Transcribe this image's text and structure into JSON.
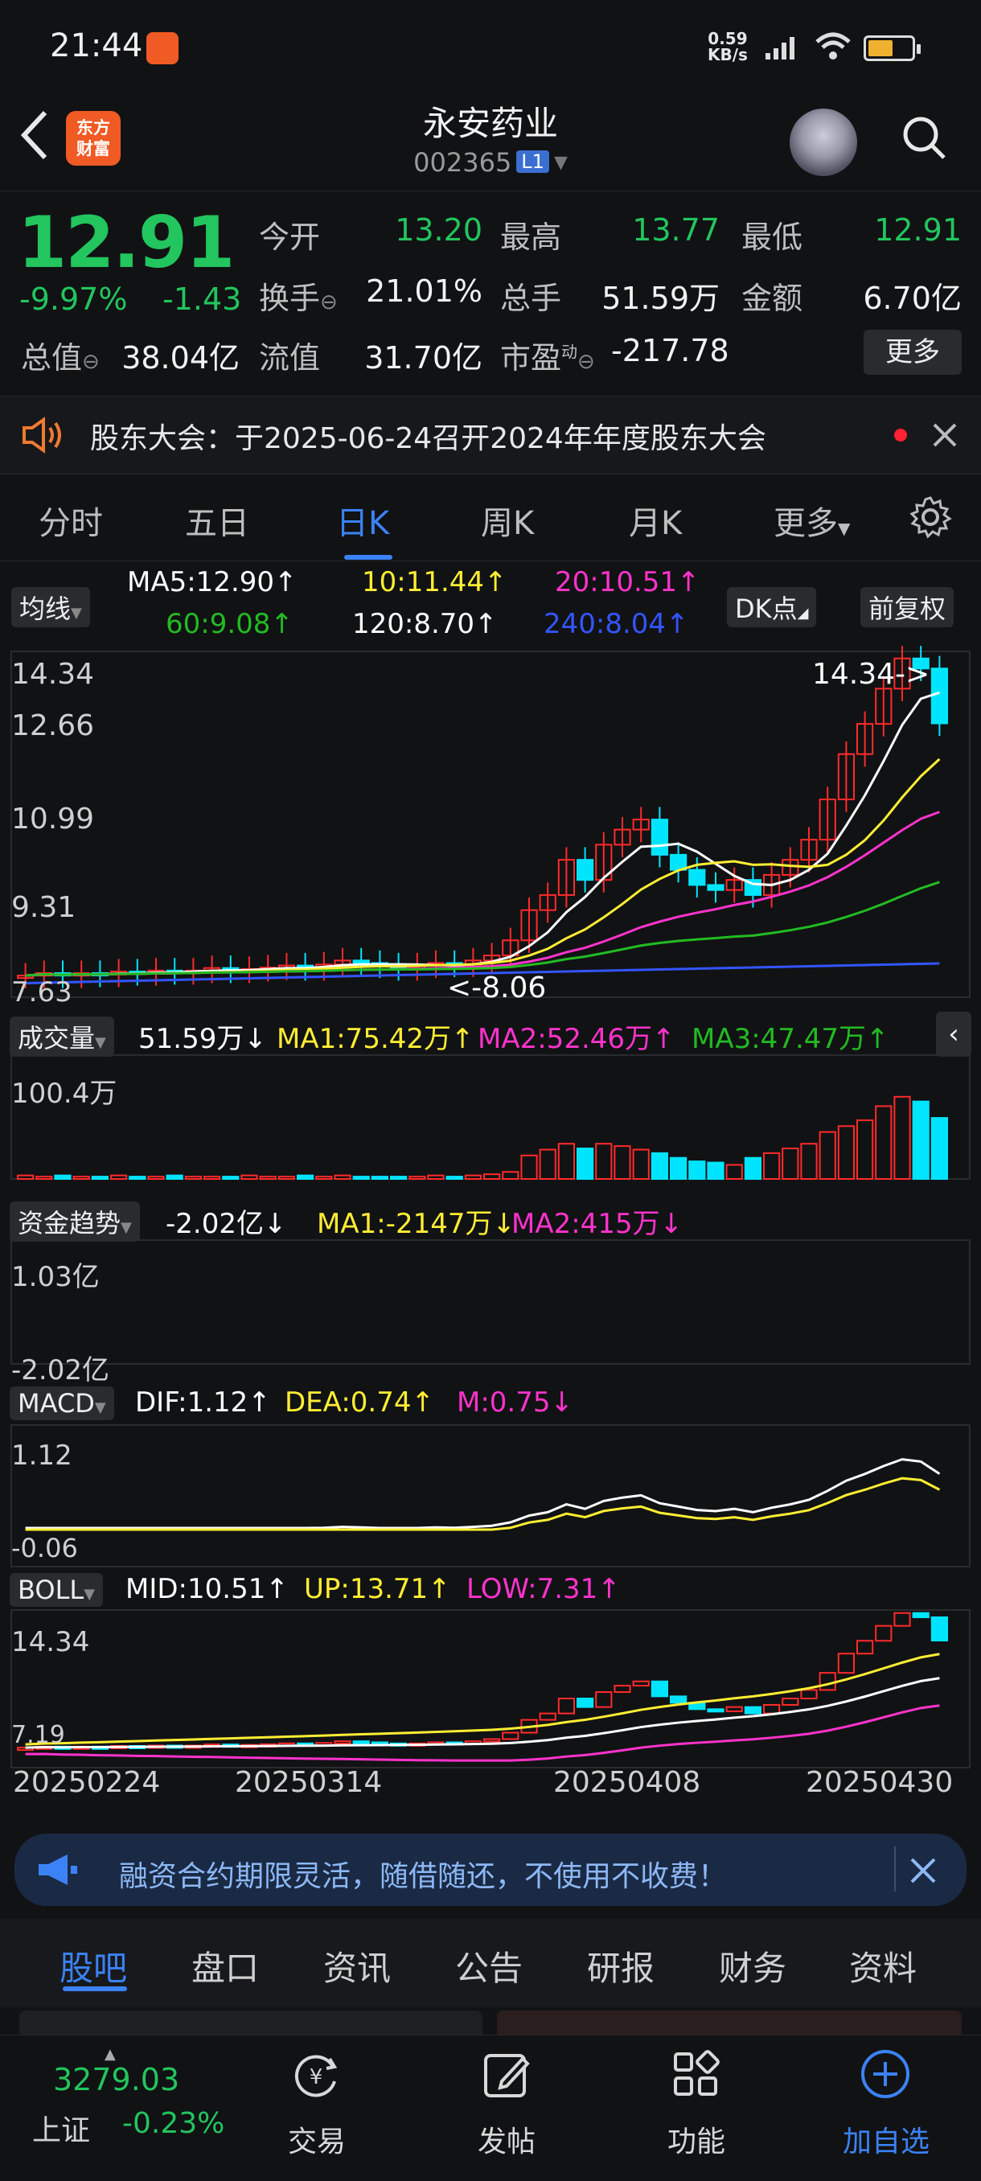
{
  "status_bar": {
    "time": "21:44",
    "speed_top": "0.59",
    "speed_bottom": "KB/s"
  },
  "header": {
    "logo_line1": "东方",
    "logo_line2": "财富",
    "stock_name": "永安药业",
    "stock_code": "002365",
    "level": "L1"
  },
  "quote": {
    "price": "12.91",
    "change_pct": "-9.97%",
    "change": "-1.43",
    "open_label": "今开",
    "open": "13.20",
    "high_label": "最高",
    "high": "13.77",
    "low_label": "最低",
    "low": "12.91",
    "turnover_label": "换手",
    "turnover": "21.01%",
    "volume_label": "总手",
    "volume": "51.59万",
    "amount_label": "金额",
    "amount": "6.70亿",
    "mcap_label": "总值",
    "mcap": "38.04亿",
    "float_label": "流值",
    "float": "31.70亿",
    "pe_label": "市盈",
    "pe_sup": "动",
    "pe": "-217.78",
    "more": "更多"
  },
  "notice": {
    "text": "股东大会：于2025-06-24召开2024年年度股东大会"
  },
  "period_tabs": [
    "分时",
    "五日",
    "日K",
    "周K",
    "月K",
    "更多"
  ],
  "ma_row": {
    "selector": "均线",
    "ma5": "MA5:12.90↑",
    "ma10": "10:11.44↑",
    "ma20": "20:10.51↑",
    "ma60": "60:9.08↑",
    "ma120": "120:8.70↑",
    "ma240": "240:8.04↑",
    "dk": "DK点",
    "adjust": "前复权"
  },
  "kline": {
    "y_top": "14.34",
    "y2": "12.66",
    "y3": "10.99",
    "y4": "9.31",
    "y_bottom": "7.63",
    "max_mark": "14.34->",
    "min_mark": "<-8.06"
  },
  "volume": {
    "selector": "成交量",
    "vol": "51.59万↓",
    "ma1": "MA1:75.42万↑",
    "ma2": "MA2:52.46万↑",
    "ma3": "MA3:47.47万↑",
    "y_top": "100.4万"
  },
  "fund": {
    "selector": "资金趋势",
    "val": "-2.02亿↓",
    "ma1": "MA1:-2147万↓",
    "ma2": "MA2:415万↓",
    "y_top": "1.03亿",
    "y_bottom": "-2.02亿"
  },
  "macd": {
    "selector": "MACD",
    "dif": "DIF:1.12↑",
    "dea": "DEA:0.74↑",
    "m": "M:0.75↓",
    "y_top": "1.12",
    "y_bottom": "-0.06"
  },
  "boll": {
    "selector": "BOLL",
    "mid": "MID:10.51↑",
    "up": "UP:13.71↑",
    "low": "LOW:7.31↑",
    "y_top": "14.34",
    "y_bottom": "7.19"
  },
  "dates": [
    "20250224",
    "20250314",
    "20250408",
    "20250430"
  ],
  "ad": {
    "text": "融资合约期限灵活，随借随还，不使用不收费！"
  },
  "bottom_tabs": [
    "股吧",
    "盘口",
    "资讯",
    "公告",
    "研报",
    "财务",
    "资料"
  ],
  "footer": {
    "index_value": "3279.03",
    "index_name": "上证",
    "index_change": "-0.23%",
    "trade": "交易",
    "post": "发帖",
    "func": "功能",
    "add": "加自选"
  },
  "colors": {
    "up": "#ff2a2a",
    "down": "#00e5ff",
    "green": "#22c55e",
    "accent": "#3b82f6",
    "ma5": "#ffffff",
    "ma10": "#ffee33",
    "ma20": "#ff33cc",
    "ma60": "#22bb22",
    "ma240": "#3355ff"
  }
}
